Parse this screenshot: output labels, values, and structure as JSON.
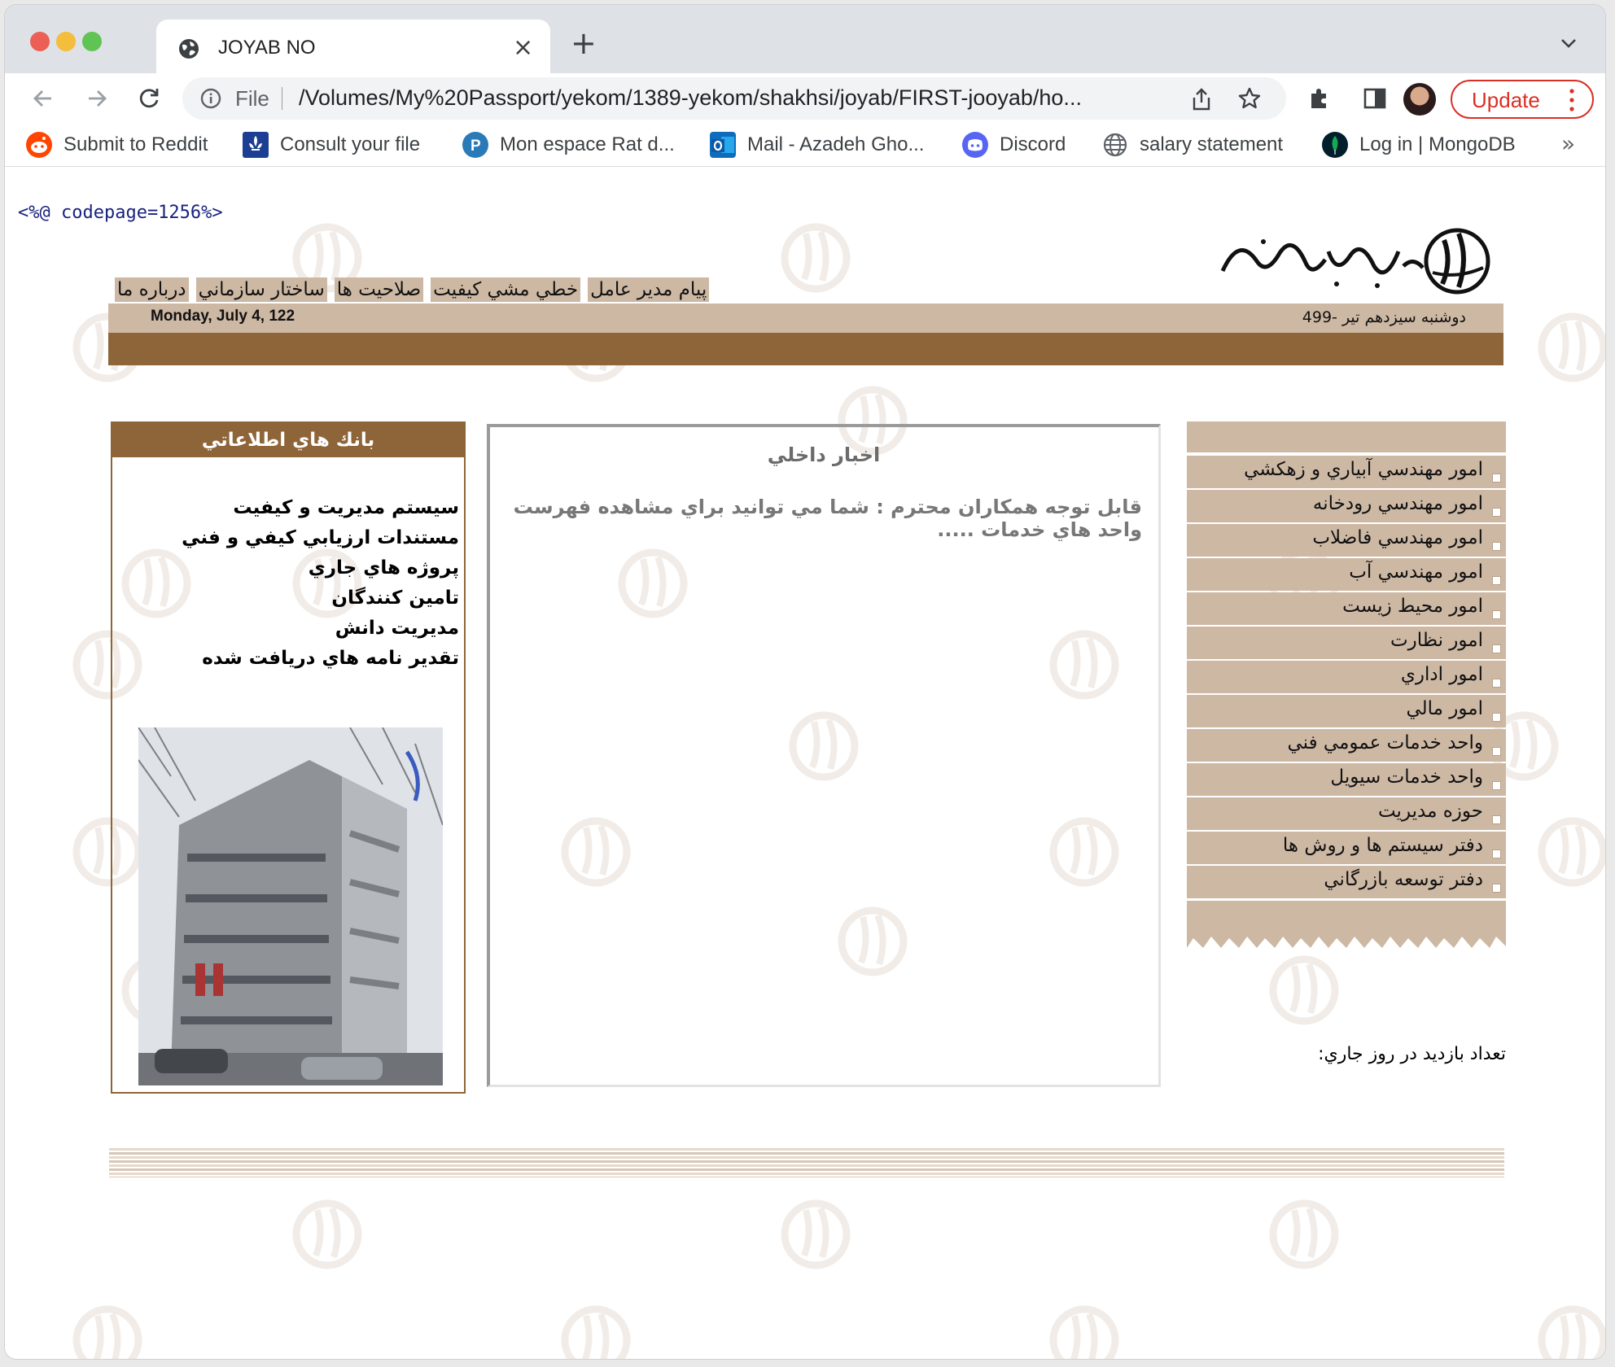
{
  "browser": {
    "tab_title": "JOYAB NO",
    "tab_close": "×",
    "new_tab": "+",
    "url_scheme": "File",
    "url": "/Volumes/My%20Passport/yekom/1389-yekom/shakhsi/joyab/FIRST-jooyab/ho...",
    "update_label": "Update",
    "bookmarks": [
      {
        "label": "Submit to Reddit",
        "icon": "reddit-icon",
        "color": "#ff4500"
      },
      {
        "label": "Consult your file",
        "icon": "fleur-de-lis-icon",
        "color": "#1c3f94"
      },
      {
        "label": "Mon espace Rat d...",
        "icon": "p-circle-icon",
        "color": "#2a7ab8"
      },
      {
        "label": "Mail - Azadeh Gho...",
        "icon": "outlook-icon",
        "color": "#0f6cbd"
      },
      {
        "label": "Discord",
        "icon": "discord-icon",
        "color": "#5865f2"
      },
      {
        "label": "salary statement",
        "icon": "globe-icon",
        "color": "#5f6368"
      },
      {
        "label": "Log in | MongoDB",
        "icon": "mongodb-leaf-icon",
        "color": "#13aa52"
      }
    ],
    "bookmarks_more": "»"
  },
  "page": {
    "codepage_text": "<%@ codepage=1256%>",
    "topnav": [
      "پيام مدير عامل",
      "خطي مشي كيفيت",
      "صلاحيت ها",
      "ساختار سازماني",
      "درباره ما"
    ],
    "date_en": "Monday, July 4, 122",
    "date_fa": "دوشنبه سيزدهم تير -499",
    "left_box": {
      "title": "بانك هاي اطلاعاتي",
      "links": [
        "سيستم مديريت و كيفيت",
        "مستندات ارزيابي كيفي و فني",
        "پروژه هاي جاري",
        "تامين كنندگان",
        "مديريت دانش",
        "تقدير نامه هاي دريافت شده"
      ]
    },
    "center_box": {
      "title": "اخبار داخلي",
      "body": "قابل توجه همكاران محترم : شما مي توانيد براي مشاهده فهرست واحد هاي خدمات ....."
    },
    "right_menu": [
      "امور مهندسي آبياري و زهكشي",
      "امور مهندسي رودخانه",
      "امور مهندسي فاضلاب",
      "امور مهندسي آب",
      "امور محيط زيست",
      "امور نظارت",
      "امور اداري",
      "امور مالي",
      "واحد خدمات عمومي فني",
      "واحد خدمات سيويل",
      "حوزه مديريت",
      "دفتر سيستم ها و روش ها",
      "دفتر توسعه بازرگاني"
    ],
    "visits_label": "تعداد بازديد در روز جاري:",
    "colors": {
      "brown": "#8e6539",
      "beige": "#cdb8a4"
    }
  }
}
